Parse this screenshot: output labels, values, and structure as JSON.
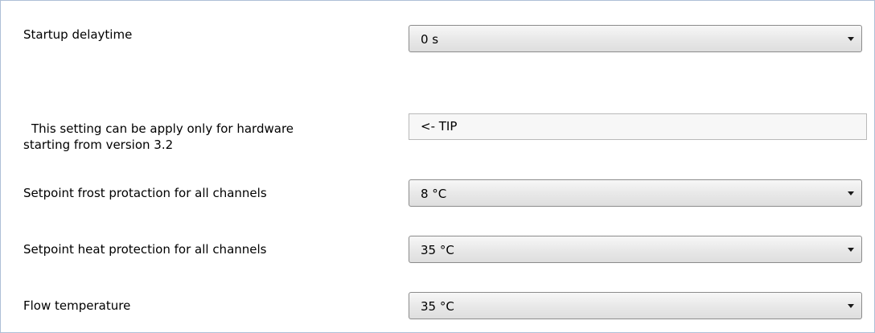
{
  "settings": {
    "startup_delay": {
      "label": "Startup delaytime",
      "value": "0 s"
    },
    "tip": {
      "label_line1": "This setting can be apply only for hardware",
      "label_line2": "starting from version 3.2",
      "value": "<- TIP"
    },
    "frost_protection": {
      "label": "Setpoint frost protaction for all channels",
      "value": "8 °C"
    },
    "heat_protection": {
      "label": "Setpoint heat protection for all channels",
      "value": "35 °C"
    },
    "flow_temperature": {
      "label": "Flow temperature",
      "value": "35 °C"
    }
  },
  "icons": {
    "dropdown_arrow": "chevron-down-icon"
  }
}
